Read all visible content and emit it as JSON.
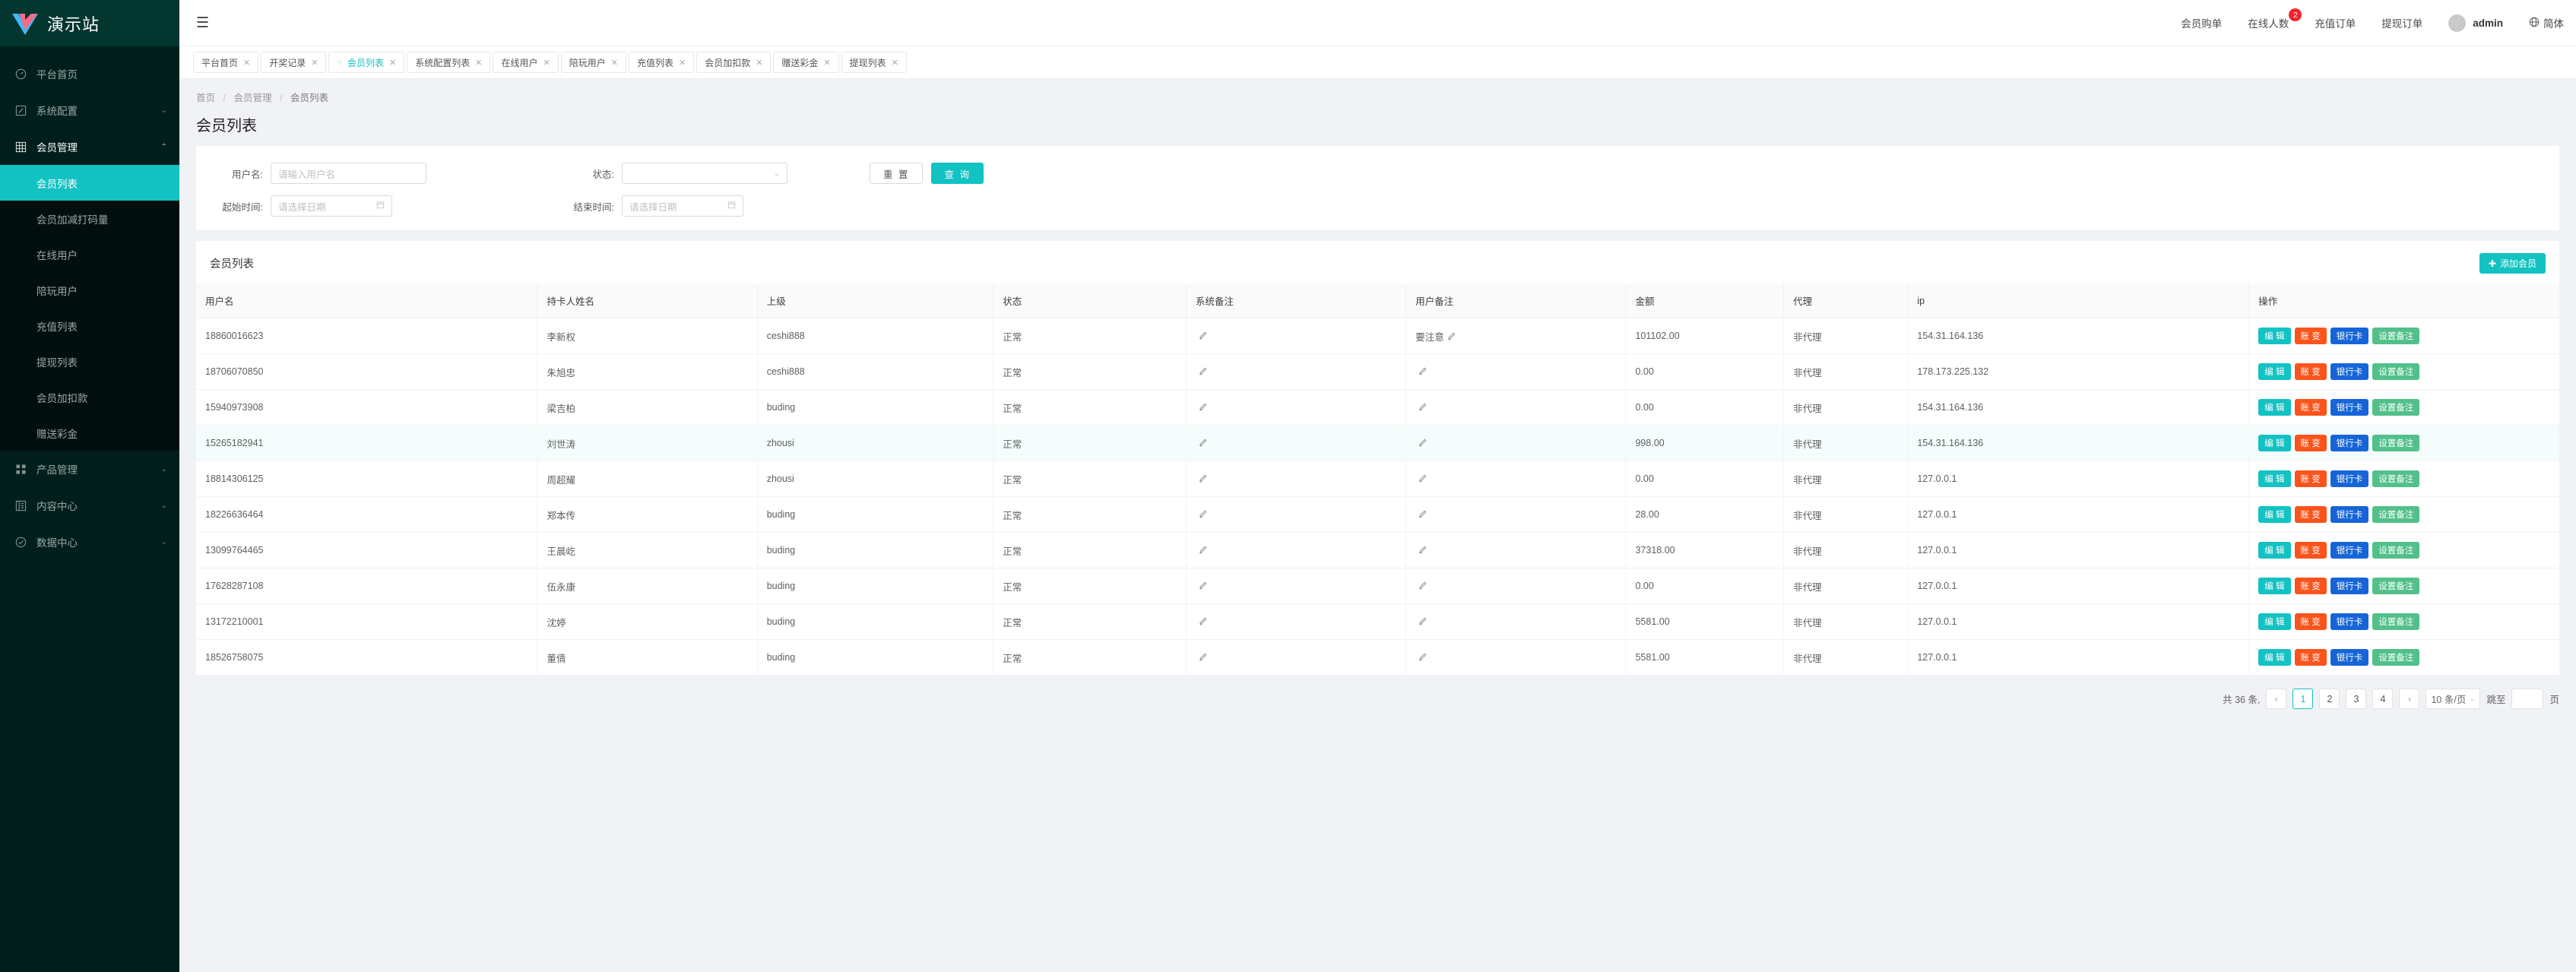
{
  "sidebar": {
    "brand": "演示站",
    "items": [
      {
        "label": "平台首页",
        "icon": "dashboard-icon",
        "arrow": ""
      },
      {
        "label": "系统配置",
        "icon": "edit-square-icon",
        "arrow": "⌄"
      },
      {
        "label": "会员管理",
        "icon": "table-grid-icon",
        "arrow": "⌃"
      }
    ],
    "submenu": [
      {
        "label": "会员列表",
        "active": true
      },
      {
        "label": "会员加减打码量",
        "active": false
      },
      {
        "label": "在线用户",
        "active": false
      },
      {
        "label": "陪玩用户",
        "active": false
      },
      {
        "label": "充值列表",
        "active": false
      },
      {
        "label": "提现列表",
        "active": false
      },
      {
        "label": "会员加扣款",
        "active": false
      },
      {
        "label": "赠送彩金",
        "active": false
      }
    ],
    "bottom_items": [
      {
        "label": "产品管理",
        "icon": "apps-icon",
        "arrow": "⌄"
      },
      {
        "label": "内容中心",
        "icon": "content-icon",
        "arrow": "⌄"
      },
      {
        "label": "数据中心",
        "icon": "check-circle-icon",
        "arrow": "⌄"
      }
    ]
  },
  "topbar": {
    "collapse_icon": "☰",
    "links": [
      {
        "label": "会员购单",
        "badge": ""
      },
      {
        "label": "在线人数",
        "badge": "2"
      },
      {
        "label": "充值订单",
        "badge": ""
      },
      {
        "label": "提现订单",
        "badge": ""
      }
    ],
    "user": "admin",
    "lang": "简体"
  },
  "tabs": [
    {
      "label": "平台首页",
      "active": false
    },
    {
      "label": "开奖记录",
      "active": false
    },
    {
      "label": "会员列表",
      "active": true
    },
    {
      "label": "系统配置列表",
      "active": false
    },
    {
      "label": "在线用户",
      "active": false
    },
    {
      "label": "陪玩用户",
      "active": false
    },
    {
      "label": "充值列表",
      "active": false
    },
    {
      "label": "会员加扣款",
      "active": false
    },
    {
      "label": "赠送彩金",
      "active": false
    },
    {
      "label": "提现列表",
      "active": false
    }
  ],
  "breadcrumb": {
    "items": [
      "首页",
      "会员管理",
      "会员列表"
    ]
  },
  "page_title": "会员列表",
  "filters": {
    "username_label": "用户名:",
    "username_placeholder": "请输入用户名",
    "username_value": "",
    "status_label": "状态:",
    "status_value": "",
    "start_label": "起始时间:",
    "start_placeholder": "请选择日期",
    "end_label": "结束时间:",
    "end_placeholder": "请选择日期",
    "reset_button": "重 置",
    "query_button": "查 询"
  },
  "table": {
    "caption": "会员列表",
    "add_button": "添加会员",
    "add_icon": "plus-icon",
    "columns": [
      "用户名",
      "持卡人姓名",
      "上级",
      "状态",
      "系统备注",
      "用户备注",
      "金额",
      "代理",
      "ip",
      "操作"
    ],
    "actions": [
      "编 辑",
      "账 变",
      "银行卡",
      "设置备注"
    ],
    "rows": [
      {
        "username": "18860016623",
        "holder": "李新权",
        "parent": "ceshi888",
        "status": "正常",
        "sys_remark": "",
        "user_remark": "要注意",
        "amount": "101102.00",
        "agent": "非代理",
        "ip": "154.31.164.136",
        "highlight": false
      },
      {
        "username": "18706070850",
        "holder": "朱旭忠",
        "parent": "ceshi888",
        "status": "正常",
        "sys_remark": "",
        "user_remark": "",
        "amount": "0.00",
        "agent": "非代理",
        "ip": "178.173.225.132",
        "highlight": false
      },
      {
        "username": "15940973908",
        "holder": "梁吉柏",
        "parent": "buding",
        "status": "正常",
        "sys_remark": "",
        "user_remark": "",
        "amount": "0.00",
        "agent": "非代理",
        "ip": "154.31.164.136",
        "highlight": false
      },
      {
        "username": "15265182941",
        "holder": "刘世涛",
        "parent": "zhousi",
        "status": "正常",
        "sys_remark": "",
        "user_remark": "",
        "amount": "998.00",
        "agent": "非代理",
        "ip": "154.31.164.136",
        "highlight": true
      },
      {
        "username": "18814306125",
        "holder": "周超耀",
        "parent": "zhousi",
        "status": "正常",
        "sys_remark": "",
        "user_remark": "",
        "amount": "0.00",
        "agent": "非代理",
        "ip": "127.0.0.1",
        "highlight": false
      },
      {
        "username": "18226636464",
        "holder": "郑本传",
        "parent": "buding",
        "status": "正常",
        "sys_remark": "",
        "user_remark": "",
        "amount": "28.00",
        "agent": "非代理",
        "ip": "127.0.0.1",
        "highlight": false
      },
      {
        "username": "13099764465",
        "holder": "王晨屹",
        "parent": "buding",
        "status": "正常",
        "sys_remark": "",
        "user_remark": "",
        "amount": "37318.00",
        "agent": "非代理",
        "ip": "127.0.0.1",
        "highlight": false
      },
      {
        "username": "17628287108",
        "holder": "伍永康",
        "parent": "buding",
        "status": "正常",
        "sys_remark": "",
        "user_remark": "",
        "amount": "0.00",
        "agent": "非代理",
        "ip": "127.0.0.1",
        "highlight": false
      },
      {
        "username": "13172210001",
        "holder": "沈婷",
        "parent": "buding",
        "status": "正常",
        "sys_remark": "",
        "user_remark": "",
        "amount": "5581.00",
        "agent": "非代理",
        "ip": "127.0.0.1",
        "highlight": false
      },
      {
        "username": "18526758075",
        "holder": "董倩",
        "parent": "buding",
        "status": "正常",
        "sys_remark": "",
        "user_remark": "",
        "amount": "5581.00",
        "agent": "非代理",
        "ip": "127.0.0.1",
        "highlight": false
      }
    ]
  },
  "pagination": {
    "total_text": "共 36 条,",
    "prev": "‹",
    "next": "›",
    "pages": [
      "1",
      "2",
      "3",
      "4"
    ],
    "current": "1",
    "page_size": "10 条/页",
    "jump_label": "跳至",
    "jump_value": "",
    "jump_unit": "页"
  },
  "colors": {
    "accent": "#13c2c2",
    "sidebar_bg": "#001f1c",
    "badge": "#f5222d",
    "action_edit": "#13c2c2",
    "action_trans": "#fa541c",
    "action_bank": "#1565d8",
    "action_remark": "#52c08a"
  }
}
